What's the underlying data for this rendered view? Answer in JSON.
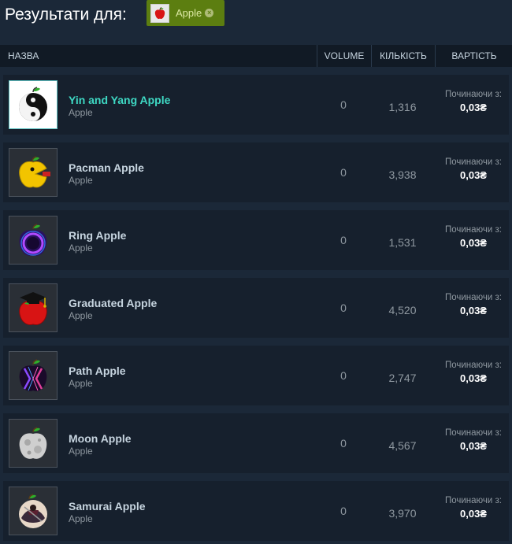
{
  "header": {
    "title": "Результати для:",
    "filter_tag": {
      "label": "Apple",
      "icon": "apple-icon"
    }
  },
  "columns": {
    "name": "НАЗВА",
    "volume": "VOLUME",
    "quantity": "КІЛЬКІСТЬ",
    "price": "ВАРТІСТЬ"
  },
  "price_prefix": "Починаючи з:",
  "items": [
    {
      "name": "Yin and Yang Apple",
      "game": "Apple",
      "volume": "0",
      "quantity": "1,316",
      "price": "0,03₴",
      "icon": "yin-yang-apple-icon"
    },
    {
      "name": "Pacman Apple",
      "game": "Apple",
      "volume": "0",
      "quantity": "3,938",
      "price": "0,03₴",
      "icon": "pacman-apple-icon"
    },
    {
      "name": "Ring Apple",
      "game": "Apple",
      "volume": "0",
      "quantity": "1,531",
      "price": "0,03₴",
      "icon": "ring-apple-icon"
    },
    {
      "name": "Graduated Apple",
      "game": "Apple",
      "volume": "0",
      "quantity": "4,520",
      "price": "0,03₴",
      "icon": "graduated-apple-icon"
    },
    {
      "name": "Path Apple",
      "game": "Apple",
      "volume": "0",
      "quantity": "2,747",
      "price": "0,03₴",
      "icon": "path-apple-icon"
    },
    {
      "name": "Moon Apple",
      "game": "Apple",
      "volume": "0",
      "quantity": "4,567",
      "price": "0,03₴",
      "icon": "moon-apple-icon"
    },
    {
      "name": "Samurai Apple",
      "game": "Apple",
      "volume": "0",
      "quantity": "3,970",
      "price": "0,03₴",
      "icon": "samurai-apple-icon"
    }
  ],
  "colors": {
    "background": "#1b2838",
    "row": "#16202d",
    "tag": "#5c7e10",
    "highlight_name": "#3ed8c3"
  }
}
